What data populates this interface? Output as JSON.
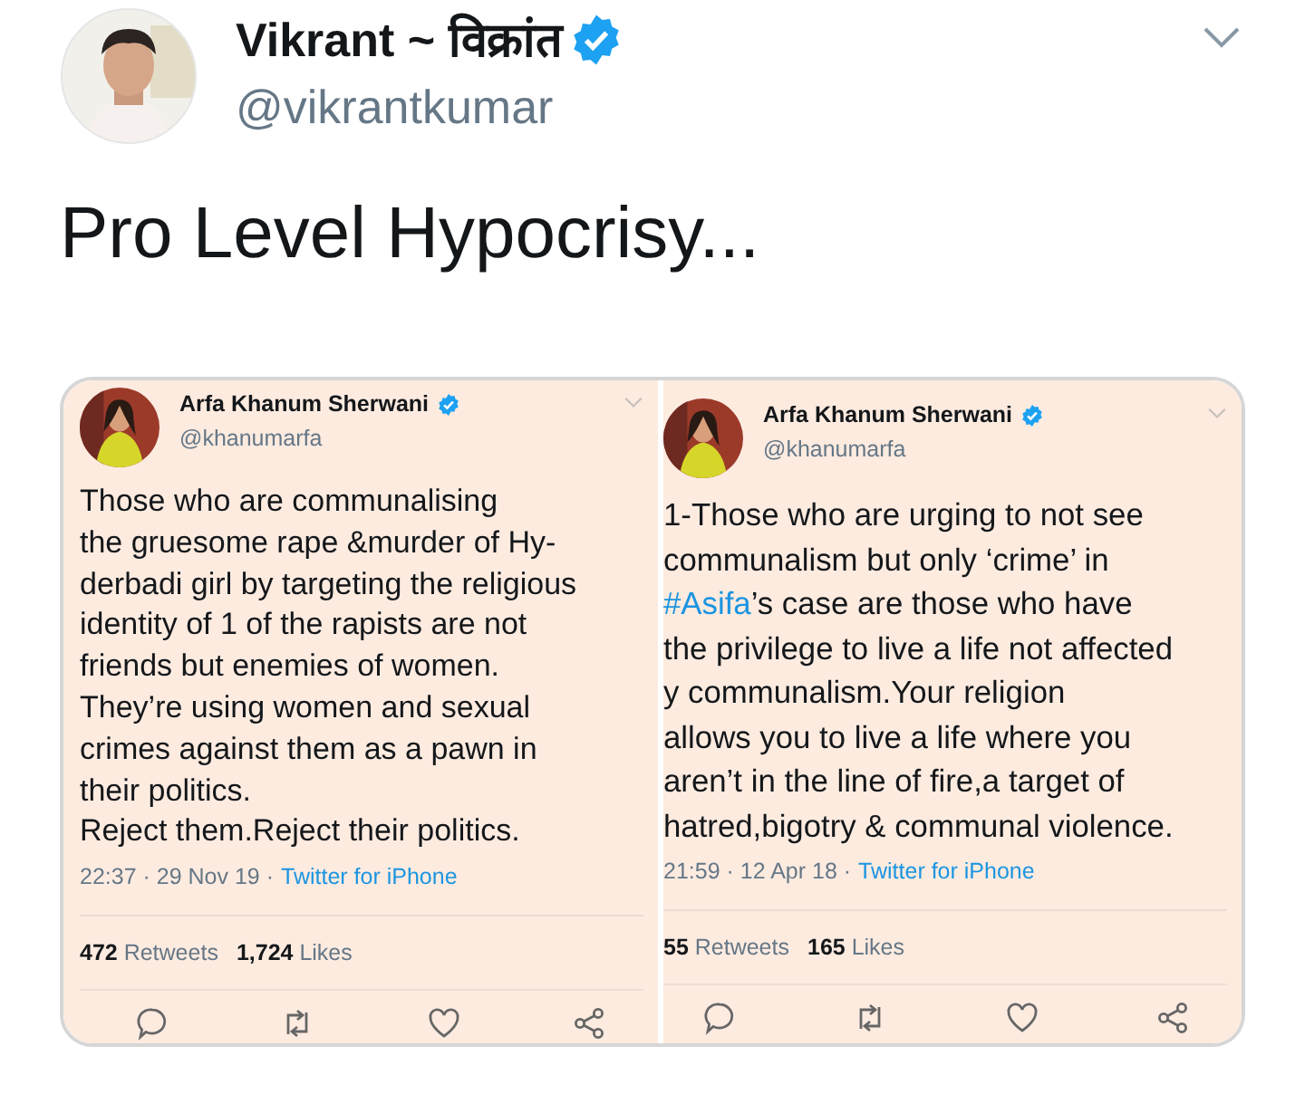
{
  "author": {
    "name": "Vikrant ~ विक्रांत",
    "verified": true,
    "handle": "@vikrantkumar"
  },
  "text": "Pro Level Hypocrisy...",
  "embedded": [
    {
      "name": "Arfa Khanum Sherwani",
      "verified": true,
      "handle": "@khanumarfa",
      "segments": [
        {
          "kind": "plain",
          "text": "Those who are communalising\nthe gruesome rape &murder of Hy-\nderbadi girl by targeting the religious\nidentity of 1 of the rapists are not\nfriends but enemies of women.\nThey’re using women and sexual\ncrimes against them as a pawn in\ntheir politics.\nReject them.Reject their politics."
        }
      ],
      "meta": "22:37 · 29 Nov 19 ·",
      "source": "Twitter for iPhone",
      "retweets": "472",
      "retweets_label": "Retweets",
      "likes": "1,724",
      "likes_label": "Likes"
    },
    {
      "name": "Arfa Khanum Sherwani",
      "verified": true,
      "handle": "@khanumarfa",
      "segments": [
        {
          "kind": "plain",
          "text": "1-Those who are urging to not see\ncommunalism but only ‘crime’ in\n"
        },
        {
          "kind": "hashtag",
          "text": "#Asifa"
        },
        {
          "kind": "plain",
          "text": "’s case are those who have\nthe privilege to live a life not affected\ny communalism.Your religion\nallows you to live a life where you\naren’t in the line of fire,a target of\nhatred,bigotry & communal violence."
        }
      ],
      "meta": "21:59 · 12 Apr 18 ·",
      "source": "Twitter for iPhone",
      "retweets": "55",
      "retweets_label": "Retweets",
      "likes": "165",
      "likes_label": "Likes"
    }
  ]
}
